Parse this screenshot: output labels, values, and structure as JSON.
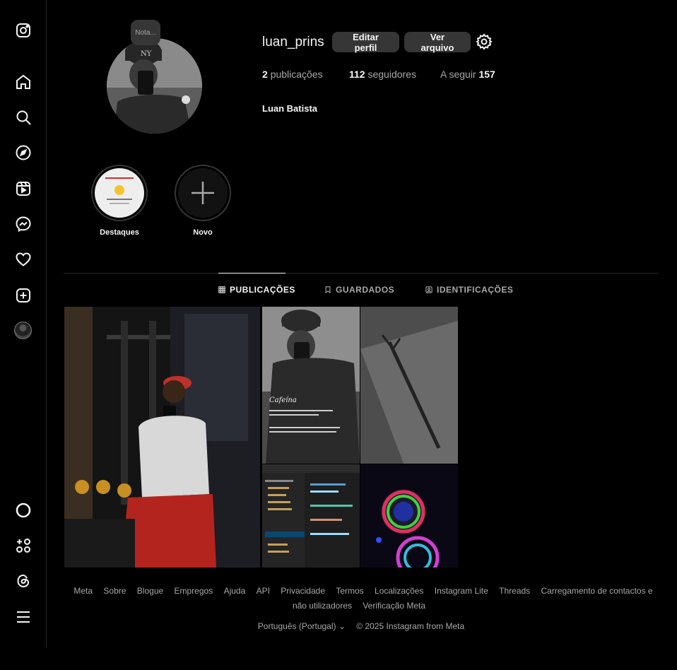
{
  "profile": {
    "note": "Nota...",
    "username": "luan_prins",
    "edit_button": "Editar perfil",
    "archive_button": "Ver arquivo",
    "posts_count": "2",
    "posts_label": "publicações",
    "followers_count": "112",
    "followers_label": "seguidores",
    "following_label": "A seguir",
    "following_count": "157",
    "full_name": "Luan Batista"
  },
  "highlights": [
    {
      "label": "Destaques"
    },
    {
      "label": "Novo"
    }
  ],
  "tabs": [
    {
      "label": "PUBLICAÇÕES",
      "active": true
    },
    {
      "label": "GUARDADOS",
      "active": false
    },
    {
      "label": "IDENTIFICAÇÕES",
      "active": false
    }
  ],
  "sidebar": {
    "icons": [
      "instagram-logo-icon",
      "home-icon",
      "search-icon",
      "explore-icon",
      "reels-icon",
      "messenger-icon",
      "heart-icon",
      "create-icon",
      "profile-avatar",
      "threads-circle-icon",
      "also-from-meta-icon",
      "threads-icon",
      "menu-icon"
    ]
  },
  "posts": {
    "post2_caption_title": "Cafeína"
  },
  "footer": {
    "links": [
      "Meta",
      "Sobre",
      "Blogue",
      "Empregos",
      "Ajuda",
      "API",
      "Privacidade",
      "Termos",
      "Localizações",
      "Instagram Lite",
      "Threads",
      "Carregamento de contactos e não utilizadores",
      "Verificação Meta"
    ],
    "language": "Português (Portugal)",
    "copyright": "© 2025 Instagram from Meta"
  },
  "colors": {
    "background": "#000000",
    "button": "#363636",
    "secondary_text": "#a8a8a8",
    "divider": "#262626"
  }
}
